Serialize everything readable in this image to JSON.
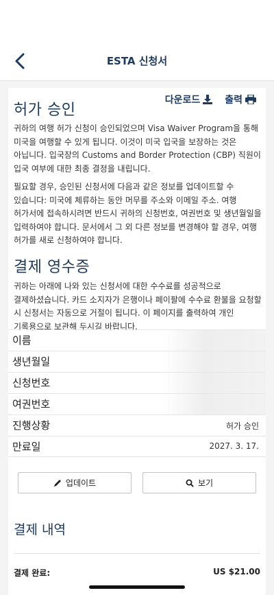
{
  "header": {
    "title": "ESTA 신청서"
  },
  "approval": {
    "heading": "허가 승인",
    "download_label": "다운로드",
    "print_label": "출력",
    "para1": "귀하의 여행 허가 신청이 승인되었으며 Visa Waiver Program을 통해 미국을 여행할 수 있게 됩니다. 이것이 미국 입국을 보장하는 것은 아닙니다. 입국장의 Customs and Border Protection (CBP) 직원이 입국 여부에 대한 최종 결정을 내립니다.",
    "para2": "필요할 경우, 승인된 신청서에 다음과 같은 정보를 업데이트할 수 있습니다: 미국에 체류하는 동안 머무를 주소와 이메일 주소. 여행 허가서에 접속하시려면 반드시 귀하의 신청번호, 여권번호 및 생년월일을 입력하여야 합니다. 문서에서 그 외 다른 정보를 변경해야 할 경우, 여행 허가를 새로 신청하여야 합니다."
  },
  "receipt": {
    "heading": "결제 영수증",
    "para": "귀하는 아래에 나와 있는 신청서에 대한 수수료를 성공적으로 결제하셨습니다. 카드 소지자가 은행이나 페이팔에 수수료 환불을 요청할 시 신청서는 자동으로 거절이 됩니다. 이 페이지를 출력하여 개인 기록용으로 보관해 두시길 바랍니다.",
    "rows": [
      {
        "label": "이름",
        "value": ""
      },
      {
        "label": "생년월일",
        "value": ""
      },
      {
        "label": "신청번호",
        "value": ""
      },
      {
        "label": "여권번호",
        "value": ""
      },
      {
        "label": "진행상황",
        "value": "허가 승인"
      },
      {
        "label": "만료일",
        "value": "2027. 3. 17."
      }
    ],
    "update_label": "업데이트",
    "view_label": "보기"
  },
  "payment": {
    "heading": "결제 내역",
    "paid_label": "결제 완료:",
    "amount": "US $21.00"
  },
  "colors": {
    "accent": "#1d3a5f",
    "background": "#f4f4f4"
  }
}
